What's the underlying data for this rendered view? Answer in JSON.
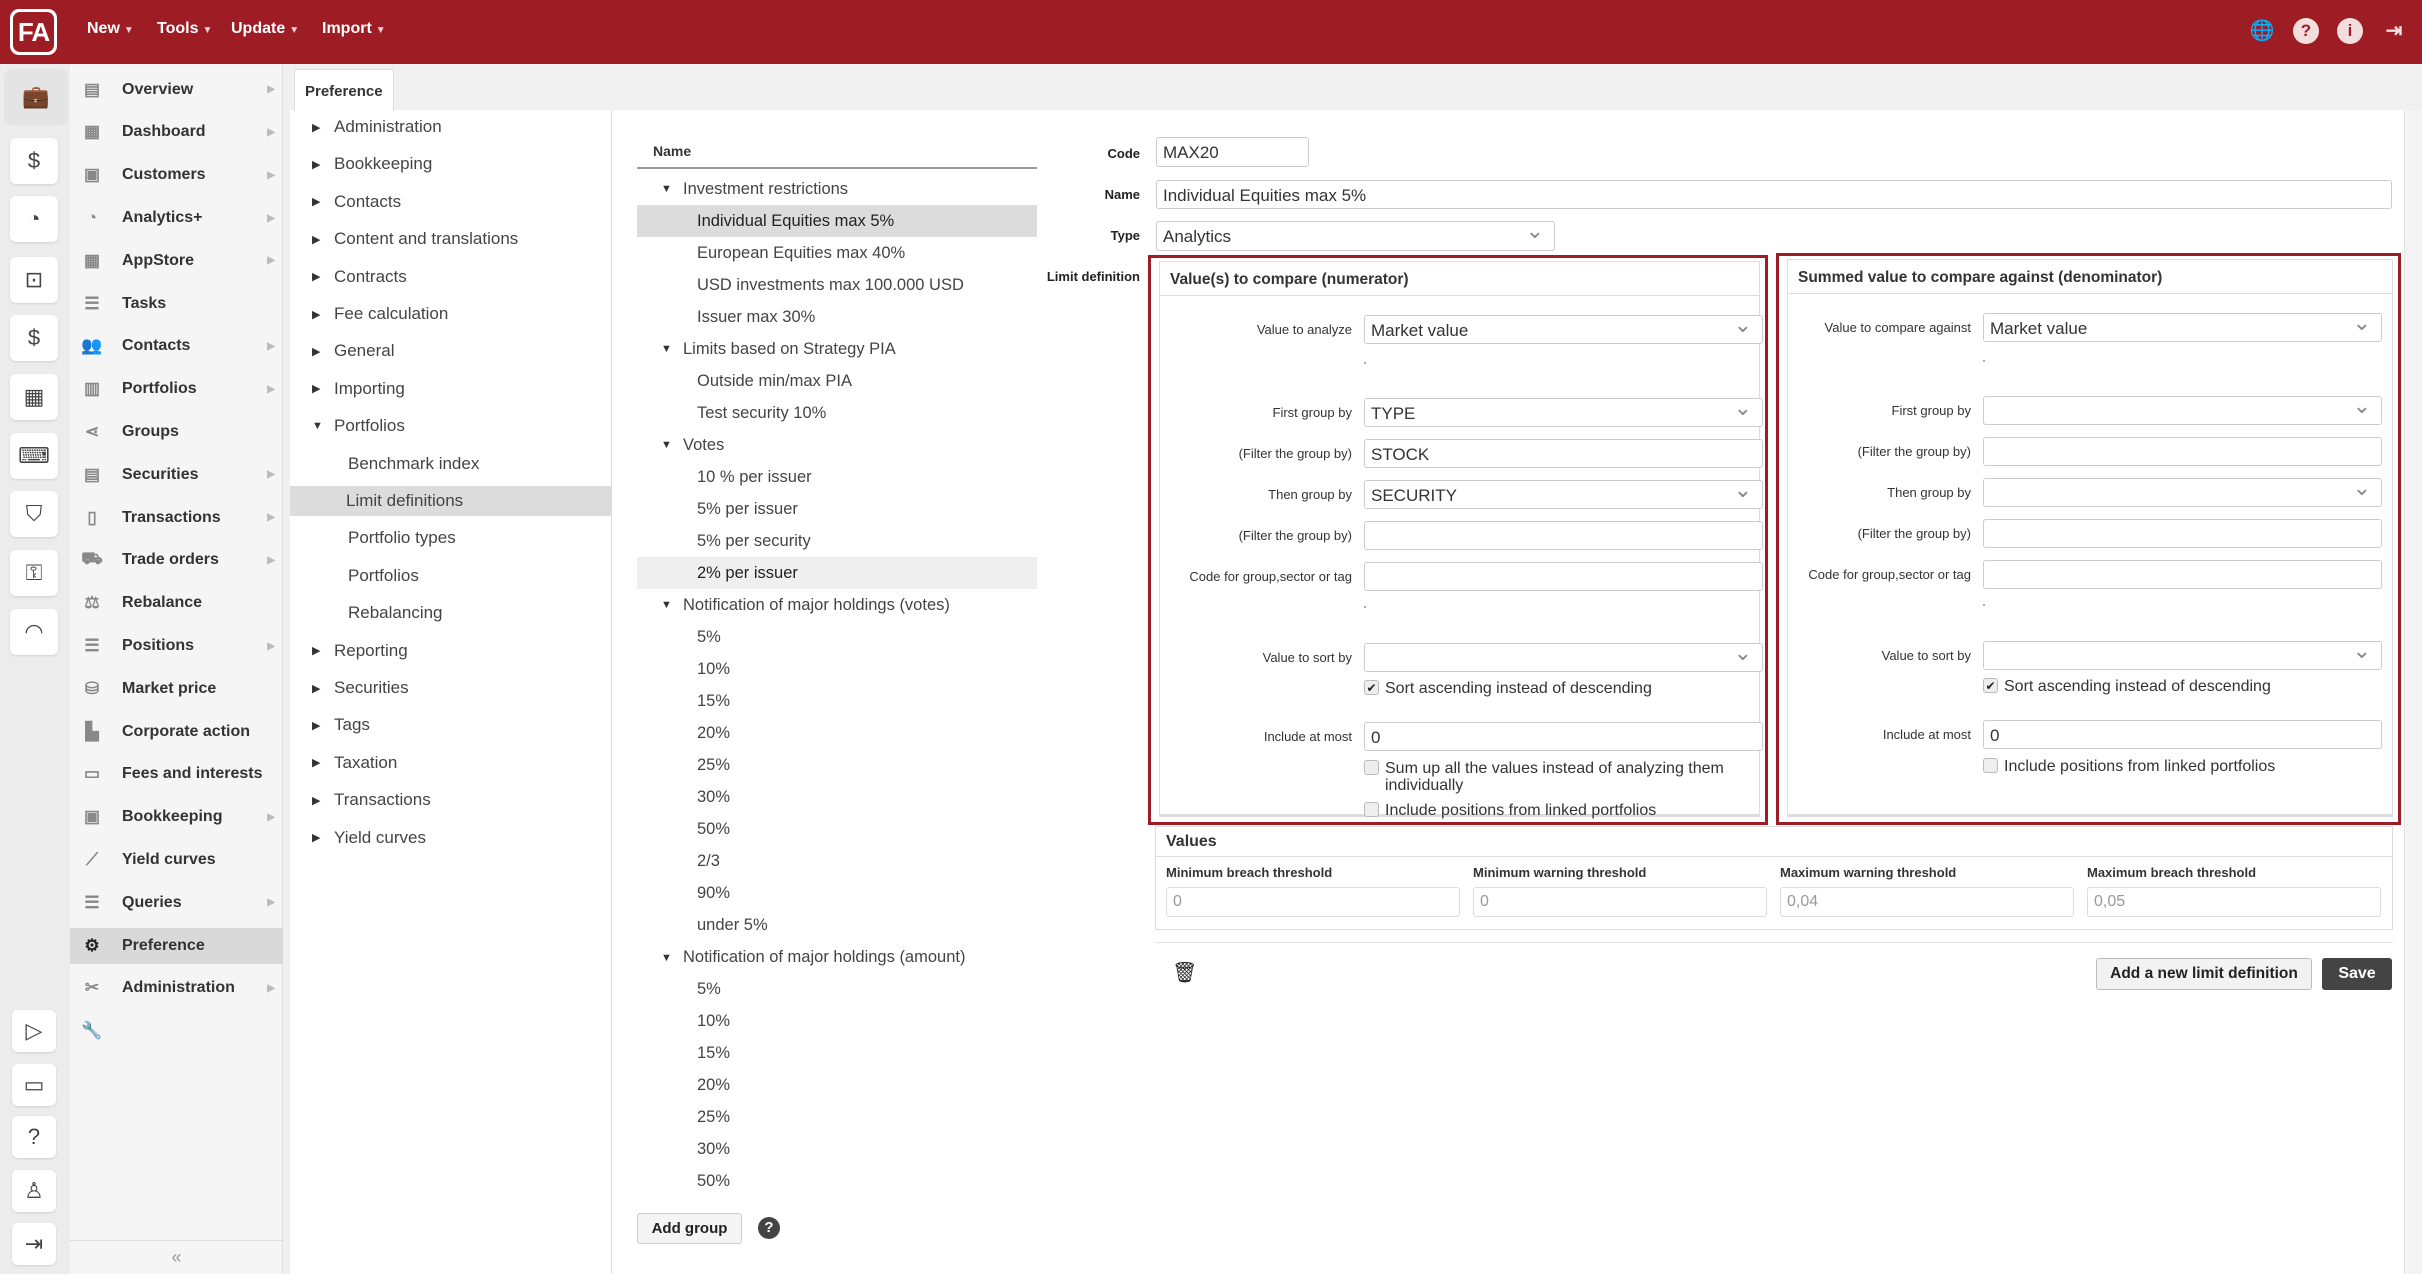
{
  "topbar": {
    "logo": "FA",
    "menus": [
      "New",
      "Tools",
      "Update",
      "Import"
    ],
    "icons": [
      "globe-icon",
      "help-icon",
      "info-icon",
      "logout-icon"
    ]
  },
  "rail": {
    "top": [
      "briefcase-icon",
      "customer-money-icon",
      "analytics-chart-icon",
      "money-hierarchy-icon",
      "hand-money-icon",
      "building-icon",
      "laptop-code-icon",
      "shield-icon",
      "key-icon",
      "gauge-icon"
    ],
    "bottom": [
      "play-icon",
      "ticket-icon",
      "help-icon",
      "user-icon",
      "logout-icon"
    ]
  },
  "nav": {
    "items": [
      {
        "label": "Overview",
        "icon": "overview-icon",
        "arrow": true
      },
      {
        "label": "Dashboard",
        "icon": "dashboard-icon",
        "arrow": true
      },
      {
        "label": "Customers",
        "icon": "customers-icon",
        "arrow": true
      },
      {
        "label": "Analytics+",
        "icon": "analytics-icon",
        "arrow": true
      },
      {
        "label": "AppStore",
        "icon": "appstore-icon",
        "arrow": true
      },
      {
        "label": "Tasks",
        "icon": "tasks-icon",
        "arrow": false
      },
      {
        "label": "Contacts",
        "icon": "contacts-icon",
        "arrow": true
      },
      {
        "label": "Portfolios",
        "icon": "portfolios-icon",
        "arrow": true
      },
      {
        "label": "Groups",
        "icon": "share-icon",
        "arrow": false
      },
      {
        "label": "Securities",
        "icon": "securities-icon",
        "arrow": true
      },
      {
        "label": "Transactions",
        "icon": "document-icon",
        "arrow": true
      },
      {
        "label": "Trade orders",
        "icon": "cart-icon",
        "arrow": true
      },
      {
        "label": "Rebalance",
        "icon": "scale-icon",
        "arrow": false
      },
      {
        "label": "Positions",
        "icon": "list-icon",
        "arrow": true
      },
      {
        "label": "Market price",
        "icon": "coins-icon",
        "arrow": false
      },
      {
        "label": "Corporate action",
        "icon": "corporate-icon",
        "arrow": false
      },
      {
        "label": "Fees and interests",
        "icon": "fees-icon",
        "arrow": false
      },
      {
        "label": "Bookkeeping",
        "icon": "bookkeeping-icon",
        "arrow": true
      },
      {
        "label": "Yield curves",
        "icon": "line-chart-icon",
        "arrow": false
      },
      {
        "label": "Queries",
        "icon": "queries-icon",
        "arrow": true
      },
      {
        "label": "Preference",
        "icon": "gears-icon",
        "arrow": false,
        "selected": true
      },
      {
        "label": "Administration",
        "icon": "tools-icon",
        "arrow": true
      },
      {
        "label": "",
        "icon": "wrench-icon",
        "arrow": false
      }
    ],
    "collapse": "«"
  },
  "preference": {
    "tab": "Preference",
    "tree": [
      {
        "label": "Administration",
        "level": 0,
        "state": "collapsed"
      },
      {
        "label": "Bookkeeping",
        "level": 0,
        "state": "collapsed"
      },
      {
        "label": "Contacts",
        "level": 0,
        "state": "collapsed"
      },
      {
        "label": "Content and translations",
        "level": 0,
        "state": "collapsed"
      },
      {
        "label": "Contracts",
        "level": 0,
        "state": "collapsed"
      },
      {
        "label": "Fee calculation",
        "level": 0,
        "state": "collapsed"
      },
      {
        "label": "General",
        "level": 0,
        "state": "collapsed"
      },
      {
        "label": "Importing",
        "level": 0,
        "state": "collapsed"
      },
      {
        "label": "Portfolios",
        "level": 0,
        "state": "expanded"
      },
      {
        "label": "Benchmark index",
        "level": 1
      },
      {
        "label": "Limit definitions",
        "level": 1,
        "selected": true
      },
      {
        "label": "Portfolio types",
        "level": 1
      },
      {
        "label": "Portfolios",
        "level": 1
      },
      {
        "label": "Rebalancing",
        "level": 1
      },
      {
        "label": "Reporting",
        "level": 0,
        "state": "collapsed"
      },
      {
        "label": "Securities",
        "level": 0,
        "state": "collapsed"
      },
      {
        "label": "Tags",
        "level": 0,
        "state": "collapsed"
      },
      {
        "label": "Taxation",
        "level": 0,
        "state": "collapsed"
      },
      {
        "label": "Transactions",
        "level": 0,
        "state": "collapsed"
      },
      {
        "label": "Yield curves",
        "level": 0,
        "state": "collapsed"
      }
    ]
  },
  "list": {
    "header": "Name",
    "rows": [
      {
        "label": "Investment restrictions",
        "group": true
      },
      {
        "label": "Individual Equities max 5%",
        "selected": true
      },
      {
        "label": "European Equities max 40%"
      },
      {
        "label": "USD investments max 100.000 USD"
      },
      {
        "label": "Issuer max 30%"
      },
      {
        "label": "Limits based on Strategy PIA",
        "group": true
      },
      {
        "label": "Outside min/max PIA"
      },
      {
        "label": "Test security 10%"
      },
      {
        "label": "Votes",
        "group": true
      },
      {
        "label": "10 % per issuer"
      },
      {
        "label": "5% per issuer"
      },
      {
        "label": "5% per security"
      },
      {
        "label": "2% per issuer",
        "hover": true
      },
      {
        "label": "Notification of major holdings (votes)",
        "group": true
      },
      {
        "label": "5%"
      },
      {
        "label": "10%"
      },
      {
        "label": "15%"
      },
      {
        "label": "20%"
      },
      {
        "label": "25%"
      },
      {
        "label": "30%"
      },
      {
        "label": "50%"
      },
      {
        "label": "2/3"
      },
      {
        "label": "90%"
      },
      {
        "label": "under 5%"
      },
      {
        "label": "Notification of major holdings (amount)",
        "group": true
      },
      {
        "label": "5%"
      },
      {
        "label": "10%"
      },
      {
        "label": "15%"
      },
      {
        "label": "20%"
      },
      {
        "label": "25%"
      },
      {
        "label": "30%"
      },
      {
        "label": "50%"
      }
    ],
    "add_group": "Add group"
  },
  "form": {
    "code_label": "Code",
    "code": "MAX20",
    "name_label": "Name",
    "name": "Individual Equities max 5%",
    "type_label": "Type",
    "type": "Analytics",
    "limit_label": "Limit definition",
    "numerator": {
      "title": "Value(s) to compare (numerator)",
      "value_label": "Value to analyze",
      "value": "Market value",
      "first_group_label": "First group by",
      "first_group": "TYPE",
      "filter1_label": "(Filter the group by)",
      "filter1": "STOCK",
      "then_group_label": "Then group by",
      "then_group": "SECURITY",
      "filter2_label": "(Filter the group by)",
      "filter2": "",
      "code_label": "Code for group,sector or tag",
      "code": "",
      "sort_label": "Value to sort by",
      "sort": "",
      "sort_asc": "Sort ascending instead of descending",
      "sort_asc_checked": true,
      "include_label": "Include at most",
      "include": "0",
      "sum_up": "Sum up all the values instead of analyzing them individually",
      "sum_up_checked": false,
      "linked": "Include positions from linked portfolios",
      "linked_checked": false
    },
    "denominator": {
      "title": "Summed value to compare against (denominator)",
      "value_label": "Value to compare against",
      "value": "Market value",
      "first_group_label": "First group by",
      "first_group": "",
      "filter1_label": "(Filter the group by)",
      "filter1": "",
      "then_group_label": "Then group by",
      "then_group": "",
      "filter2_label": "(Filter the group by)",
      "filter2": "",
      "code_label": "Code for group,sector or tag",
      "code": "",
      "sort_label": "Value to sort by",
      "sort": "",
      "sort_asc": "Sort ascending instead of descending",
      "sort_asc_checked": true,
      "include_label": "Include at most",
      "include": "0",
      "linked": "Include positions from linked portfolios",
      "linked_checked": false
    },
    "values": {
      "title": "Values",
      "fields": [
        {
          "label": "Minimum breach threshold",
          "value": "0"
        },
        {
          "label": "Minimum warning threshold",
          "value": "0"
        },
        {
          "label": "Maximum warning threshold",
          "value": "0,04"
        },
        {
          "label": "Maximum breach threshold",
          "value": "0,05"
        }
      ]
    },
    "add_limit": "Add a new limit definition",
    "save": "Save"
  },
  "colors": {
    "brand": "#9e1c23",
    "highlight_border": "#9e1c23",
    "save_button": "#444444"
  }
}
